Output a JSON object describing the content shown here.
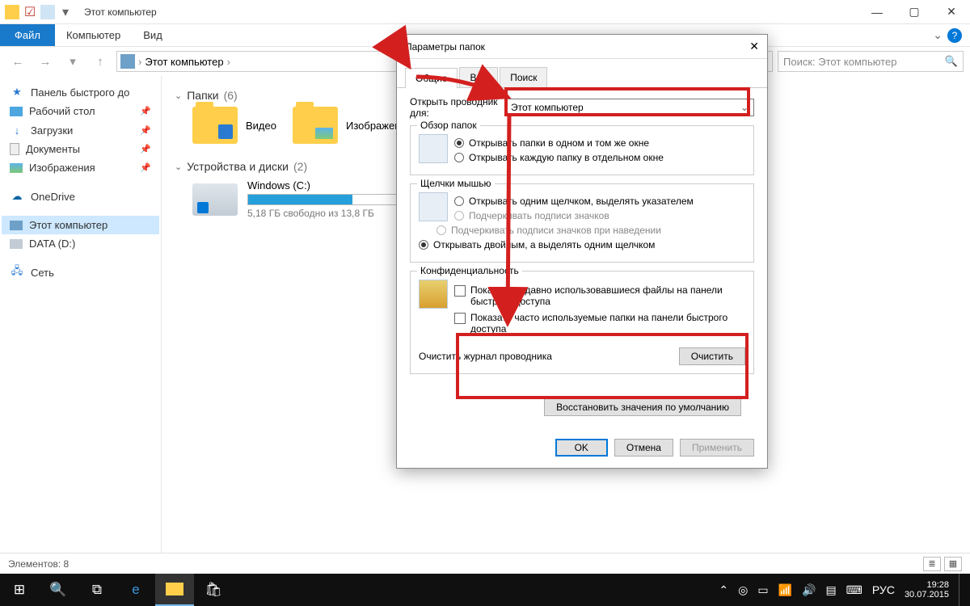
{
  "window": {
    "title": "Этот компьютер",
    "win_min": "—",
    "win_max": "▢",
    "win_close": "✕"
  },
  "ribbon": {
    "file": "Файл",
    "computer": "Компьютер",
    "view": "Вид"
  },
  "nav": {
    "breadcrumb_root": "Этот компьютер",
    "search_placeholder": "Поиск: Этот компьютер"
  },
  "sidebar": {
    "quick_access": "Панель быстрого до",
    "desktop": "Рабочий стол",
    "downloads": "Загрузки",
    "documents": "Документы",
    "pictures": "Изображения",
    "onedrive": "OneDrive",
    "this_pc": "Этот компьютер",
    "data_d": "DATA (D:)",
    "network": "Сеть"
  },
  "content": {
    "folders_header": "Папки",
    "folders_count": "(6)",
    "video": "Видео",
    "pictures": "Изображения",
    "devices_header": "Устройства и диски",
    "devices_count": "(2)",
    "drive_c_label": "Windows (C:)",
    "drive_c_free": "5,18 ГБ свободно из 13,8 ГБ"
  },
  "statusbar": {
    "elements": "Элементов: 8"
  },
  "dialog": {
    "title": "Параметры папок",
    "tab_general": "Общие",
    "tab_view": "Вид",
    "tab_search": "Поиск",
    "open_explorer_label": "Открыть проводник для:",
    "open_explorer_value": "Этот компьютер",
    "browse_folders_legend": "Обзор папок",
    "browse_same": "Открывать папки в одном и том же окне",
    "browse_separate": "Открывать каждую папку в отдельном окне",
    "click_legend": "Щелчки мышью",
    "click_single": "Открывать одним щелчком, выделять указателем",
    "click_underline_browser": "Подчеркивать подписи значков",
    "click_underline_hover": "Подчеркивать подписи значков при наведении",
    "click_double": "Открывать двойным, а выделять одним щелчком",
    "privacy_legend": "Конфиденциальность",
    "privacy_recent": "Показать недавно использовавшиеся файлы на панели быстрого доступа",
    "privacy_frequent": "Показать часто используемые папки на панели быстрого доступа",
    "clear_label": "Очистить журнал проводника",
    "clear_btn": "Очистить",
    "restore_btn": "Восстановить значения по умолчанию",
    "ok": "OK",
    "cancel": "Отмена",
    "apply": "Применить"
  },
  "taskbar": {
    "time": "19:28",
    "date": "30.07.2015",
    "lang": "РУС"
  }
}
